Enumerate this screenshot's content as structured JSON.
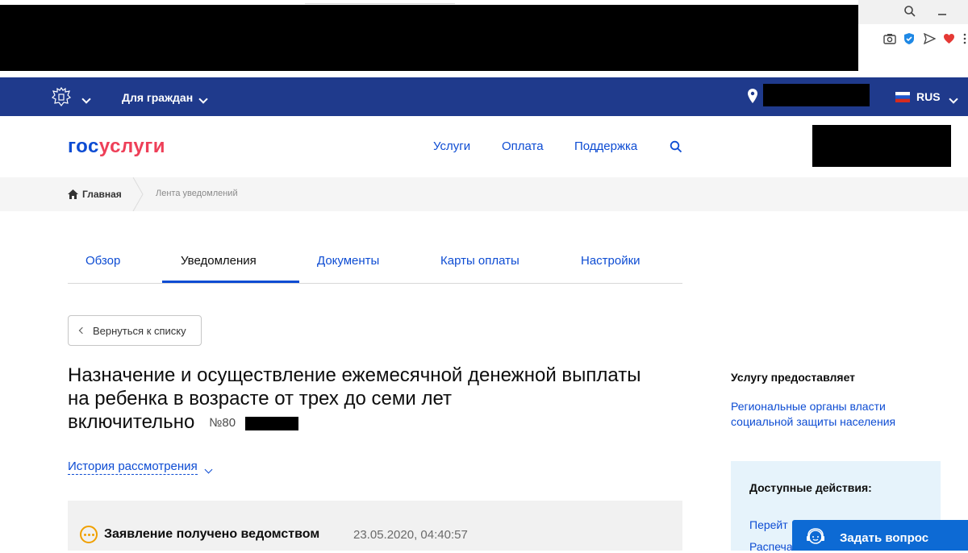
{
  "gov_bar": {
    "audience": "Для граждан",
    "language": "RUS",
    "colors": {
      "bar": "#1f3a8c"
    }
  },
  "header": {
    "logo_part1": "гос",
    "logo_part2": "услуги",
    "nav": [
      "Услуги",
      "Оплата",
      "Поддержка"
    ],
    "colors": {
      "link": "#0d4cd3",
      "logo_accent": "#ee3f58"
    }
  },
  "breadcrumbs": {
    "home": "Главная",
    "current": "Лента уведомлений"
  },
  "tabs": {
    "items": [
      "Обзор",
      "Уведомления",
      "Документы",
      "Карты оплаты",
      "Настройки"
    ],
    "active": "Уведомления"
  },
  "back_button": "Вернуться к списку",
  "application": {
    "title_lines": [
      "Назначение и осуществление ежемесячной денежной выплаты",
      "на ребенка в возрасте от трех до семи лет",
      "включительно"
    ],
    "number_prefix": "№80",
    "history_link": "История рассмотрения"
  },
  "status": {
    "text": "Заявление получено ведомством",
    "datetime": "23.05.2020, 04:40:57",
    "colors": {
      "pending": "#f0a000"
    }
  },
  "sidebar": {
    "provider_heading": "Услугу предоставляет",
    "provider_lines": [
      "Региональные органы власти",
      "социальной защиты населения"
    ],
    "actions_heading": "Доступные действия:",
    "actions": [
      "Перейт",
      "Распеча"
    ]
  },
  "ask_button": "Задать вопрос"
}
